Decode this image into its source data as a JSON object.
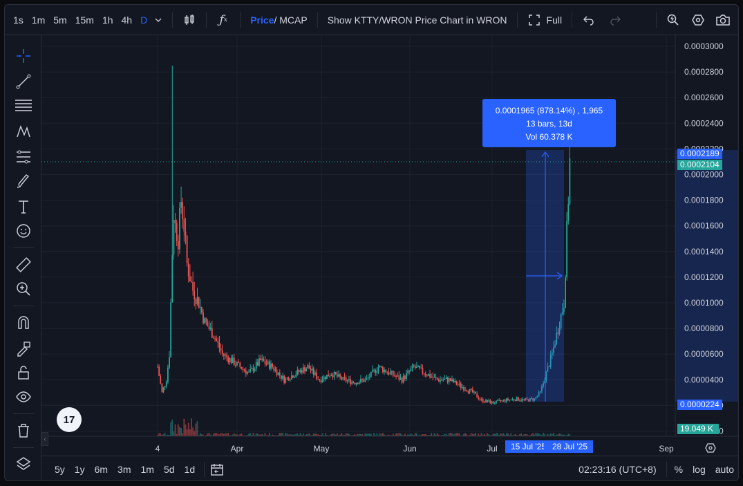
{
  "toolbar": {
    "timeframes": [
      "1s",
      "1m",
      "5m",
      "15m",
      "1h",
      "4h",
      "D"
    ],
    "active_timeframe": "D",
    "price_label": "Price",
    "mcap_label": " / MCAP",
    "show_chart_label": "Show KTTY/WRON Price Chart in WRON",
    "full_label": "Full"
  },
  "price_axis": {
    "ticks": [
      "0.0003000",
      "0.0002800",
      "0.0002600",
      "0.0002400",
      "0.0002200",
      "0.0002000",
      "0.0001800",
      "0.0001600",
      "0.0001400",
      "0.0001200",
      "0.0001000",
      "0.0000800",
      "0.0000600",
      "0.0000400",
      "0.0000200",
      "0.0000000"
    ],
    "tag_top": "0.0002189",
    "tag_last": "0.0002104",
    "tag_low": "0.0000224",
    "tag_volume": "19.049 K"
  },
  "time_axis": {
    "ticks": [
      "4",
      "Apr",
      "May",
      "Jun",
      "Jul",
      "Sep"
    ],
    "range_start": "15 Jul '25",
    "range_end": "28 Jul '25"
  },
  "measure": {
    "line1": "0.0001965 (878.14%) , 1,965",
    "line2": "13 bars, 13d",
    "line3": "Vol 60.378 K"
  },
  "bottom": {
    "ranges": [
      "5y",
      "1y",
      "6m",
      "3m",
      "1m",
      "5d",
      "1d"
    ],
    "time": "02:23:16 (UTC+8)",
    "percent": "%",
    "log": "log",
    "auto": "auto"
  },
  "colors": {
    "up": "#26a69a",
    "down": "#ef5350",
    "accent": "#2962ff",
    "background": "#131722"
  },
  "chart_data": {
    "type": "candlestick",
    "title": "KTTY/WRON",
    "ylim": [
      0,
      0.0003
    ],
    "last_price": 0.0002104,
    "measure_range": {
      "from": "15 Jul '25",
      "to": "28 Jul '25",
      "change": 0.0001965,
      "change_pct": 878.14,
      "bars": 13,
      "volume": "60.378 K"
    }
  }
}
